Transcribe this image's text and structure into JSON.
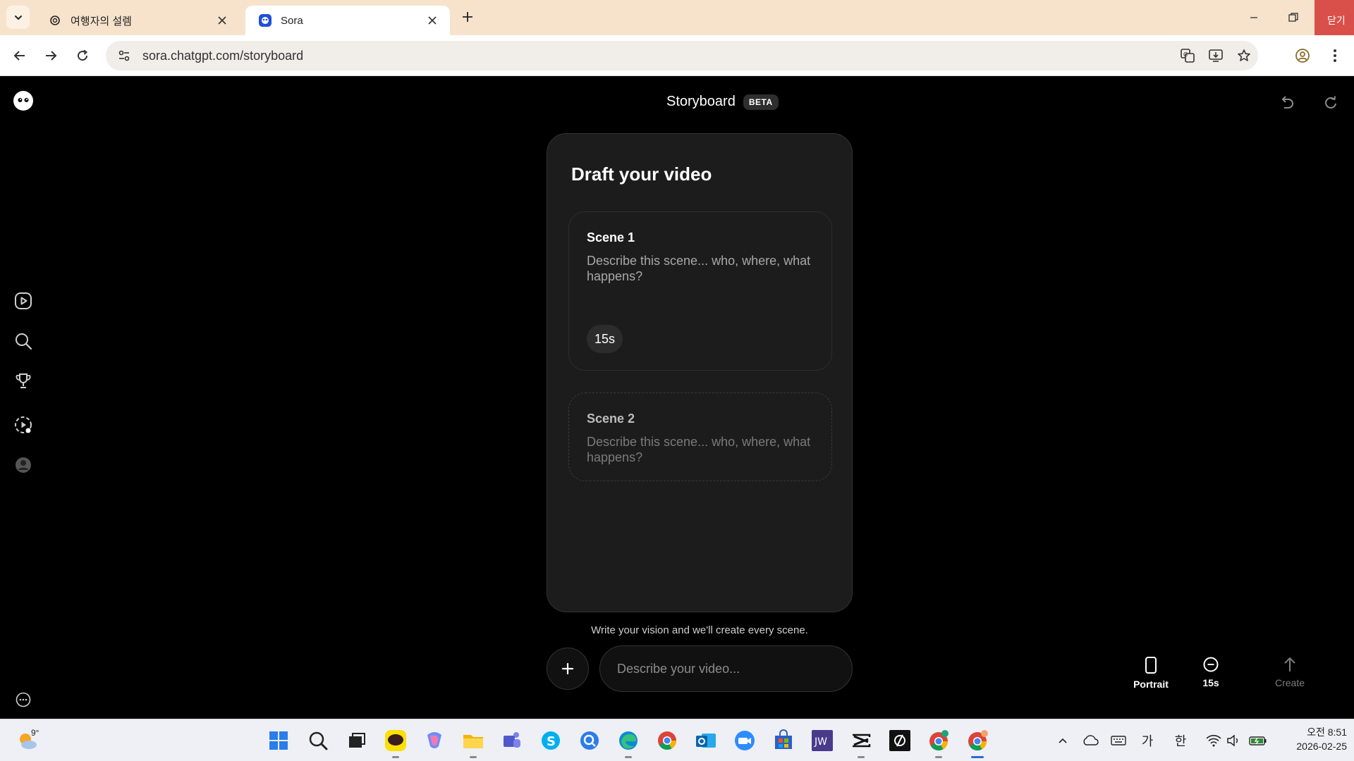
{
  "browser": {
    "tabs": [
      {
        "title": "여행자의 설렘",
        "active": false,
        "favicon": "openai-logo-icon"
      },
      {
        "title": "Sora",
        "active": true,
        "favicon": "sora-logo-icon"
      }
    ],
    "url": "sora.chatgpt.com/storyboard",
    "close_overlay_label": "닫기"
  },
  "app": {
    "header": {
      "title": "Storyboard",
      "badge": "BETA"
    },
    "sidebar_icons": [
      "play-icon",
      "search-icon",
      "trophy-icon",
      "sparkle-play-icon",
      "profile-icon",
      "more-icon"
    ],
    "panel": {
      "title": "Draft your video",
      "scenes": [
        {
          "name": "Scene 1",
          "placeholder": "Describe this scene... who, where, what happens?",
          "duration": "15s"
        },
        {
          "name": "Scene 2",
          "placeholder": "Describe this scene... who, where, what happens?"
        }
      ]
    },
    "composer": {
      "hint": "Write your vision and we'll create every scene.",
      "input_placeholder": "Describe your video...",
      "input_value": ""
    },
    "options": {
      "orientation": "Portrait",
      "duration": "15s",
      "create": "Create"
    }
  },
  "taskbar": {
    "weather_temp": "9°",
    "apps": [
      "start-icon",
      "search-icon",
      "task-view-icon",
      "kakaotalk-icon",
      "copilot-icon",
      "file-explorer-icon",
      "teams-icon",
      "skype-icon",
      "browser-app-icon",
      "edge-icon",
      "chrome-icon",
      "outlook-icon",
      "zoom-icon",
      "store-icon",
      "jw-icon",
      "capcut-icon",
      "app-icon",
      "chrome-profile-icon",
      "chrome-active-icon"
    ],
    "ime_1": "가",
    "ime_2": "한",
    "time": "오전 8:51",
    "date": "2026-02-25"
  }
}
